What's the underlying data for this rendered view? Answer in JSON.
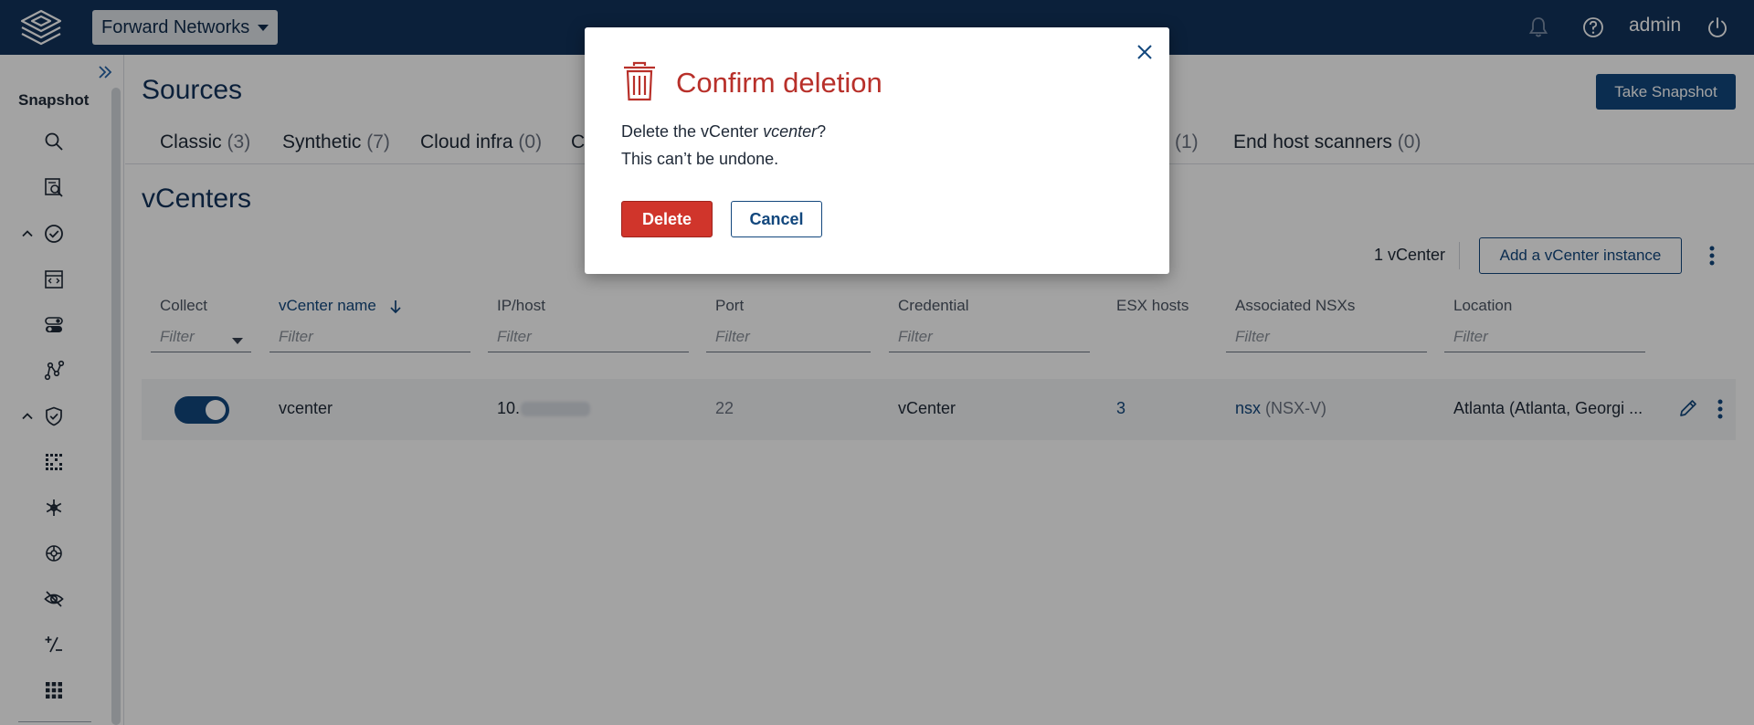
{
  "topbar": {
    "org_name": "Forward Networks",
    "user": "admin",
    "icons": [
      "logo-icon",
      "bell-icon",
      "help-icon",
      "power-icon"
    ]
  },
  "sidebar": {
    "title": "Snapshot",
    "icons": [
      "search-icon",
      "search-config-icon",
      "chevron-up-icon",
      "check-circle-icon",
      "code-file-icon",
      "toggle-list-icon",
      "topology-icon",
      "chevron-up-icon",
      "shield-check-icon",
      "grid-scan-icon",
      "snowflake-icon",
      "shield-wheel-icon",
      "eye-icon",
      "diff-icon",
      "apps-grid-icon"
    ]
  },
  "main": {
    "title": "Sources",
    "snapshot_button": "Take Snapshot",
    "tabs": [
      {
        "label": "Classic",
        "count": "(3)"
      },
      {
        "label": "Synthetic",
        "count": "(7)"
      },
      {
        "label": "Cloud infra",
        "count": "(0)"
      },
      {
        "label": "C",
        "count": ""
      },
      {
        "label": "",
        "count": "(1)"
      },
      {
        "label": "End host scanners",
        "count": "(0)"
      }
    ],
    "section_title": "vCenters",
    "count_label": "1 vCenter",
    "add_button": "Add a vCenter instance",
    "columns": [
      "Collect",
      "vCenter name",
      "IP/host",
      "Port",
      "Credential",
      "ESX hosts",
      "Associated NSXs",
      "Location"
    ],
    "filter_placeholder": "Filter",
    "row": {
      "collect_on": true,
      "name": "vcenter",
      "ip": "10.",
      "port": "22",
      "credential": "vCenter",
      "esx_hosts": "3",
      "nsx_link": "nsx",
      "nsx_type": "(NSX-V)",
      "location": "Atlanta (Atlanta, Georgi ..."
    }
  },
  "dialog": {
    "title": "Confirm deletion",
    "message_prefix": "Delete the vCenter ",
    "message_name": "vcenter",
    "message_suffix": "?",
    "message_line2": "This can’t be undone.",
    "delete_label": "Delete",
    "cancel_label": "Cancel"
  },
  "colors": {
    "topbar": "#12335c",
    "primary": "#12477d",
    "danger": "#d0352b",
    "danger_text": "#b8302a"
  }
}
